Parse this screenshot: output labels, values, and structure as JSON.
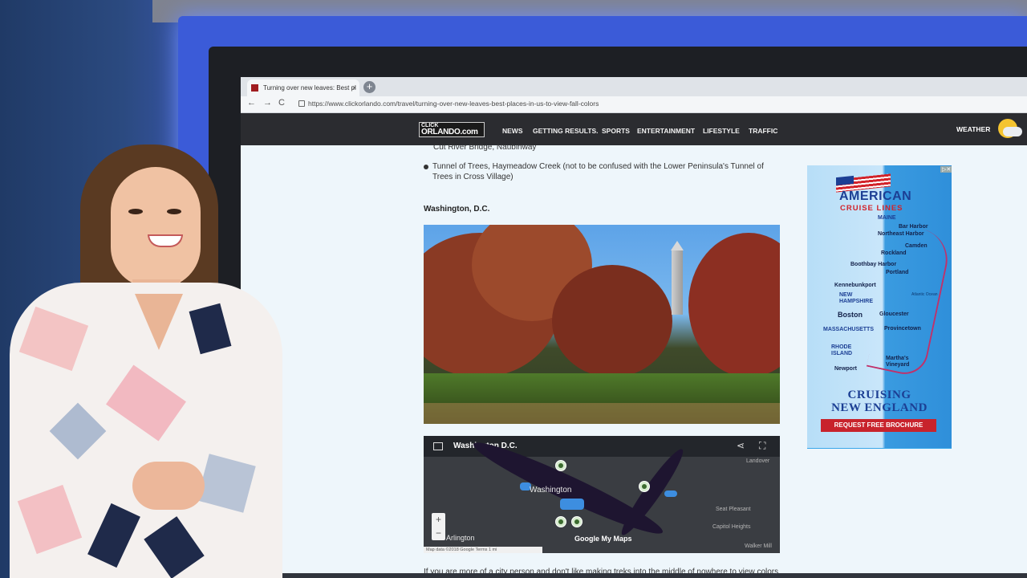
{
  "browser": {
    "tab_title": "Turning over new leaves: Best pl",
    "tab_close": "×",
    "new_tab": "+",
    "nav_back": "←",
    "nav_forward": "→",
    "nav_reload": "C",
    "url": "https://www.clickorlando.com/travel/turning-over-new-leaves-best-places-in-us-to-view-fall-colors"
  },
  "site": {
    "logo_top": "CLICK",
    "logo_main": "ORLANDO.com",
    "menu": [
      "NEWS",
      "GETTING RESULTS.",
      "SPORTS",
      "ENTERTAINMENT",
      "LIFESTYLE",
      "TRAFFIC"
    ],
    "weather_label": "WEATHER"
  },
  "article": {
    "cut_item": "Cut River Bridge, Naubinway",
    "item": "Tunnel of Trees, Haymeadow Creek (not to be confused with the Lower Peninsula's Tunnel of Trees in Cross Village)",
    "section_heading": "Washington, D.C.",
    "map": {
      "title": "Washington D.C.",
      "share_icon": "share-icon",
      "fullscreen_icon": "fullscreen-icon",
      "city_label": "Washington",
      "arlington": "Arlington",
      "labels": [
        "Landover",
        "Seat Pleasant",
        "Capitol Heights",
        "Walker Mill"
      ],
      "zoom_in": "+",
      "zoom_out": "−",
      "footer": "Map data ©2018 Google   Terms   1 mi",
      "brand": "Google My Maps"
    },
    "below_text": "If you are more of a city person and don't like making treks into the middle of nowhere to view colors"
  },
  "ad": {
    "close": "▷✕",
    "brand_line1": "AMERICAN",
    "brand_line2": "CRUISE LINES",
    "states": [
      "MAINE",
      "NEW",
      "HAMPSHIRE",
      "MASSACHUSETTS",
      "RHODE",
      "ISLAND"
    ],
    "places": [
      "Bar Harbor",
      "Northeast Harbor",
      "Camden",
      "Rockland",
      "Boothbay Harbor",
      "Portland",
      "Kennebunkport",
      "Boston",
      "Gloucester",
      "Provincetown",
      "Martha's",
      "Vineyard",
      "Newport"
    ],
    "ocean": "Atlantic Ocean",
    "cta_line1": "CRUISING",
    "cta_line2": "NEW ENGLAND",
    "button": "REQUEST FREE BROCHURE"
  },
  "colors": {
    "site_header": "#2b2c30",
    "studio_glow": "#3b5bd8",
    "ad_blue": "#1c3f94",
    "ad_red": "#c8232c"
  }
}
